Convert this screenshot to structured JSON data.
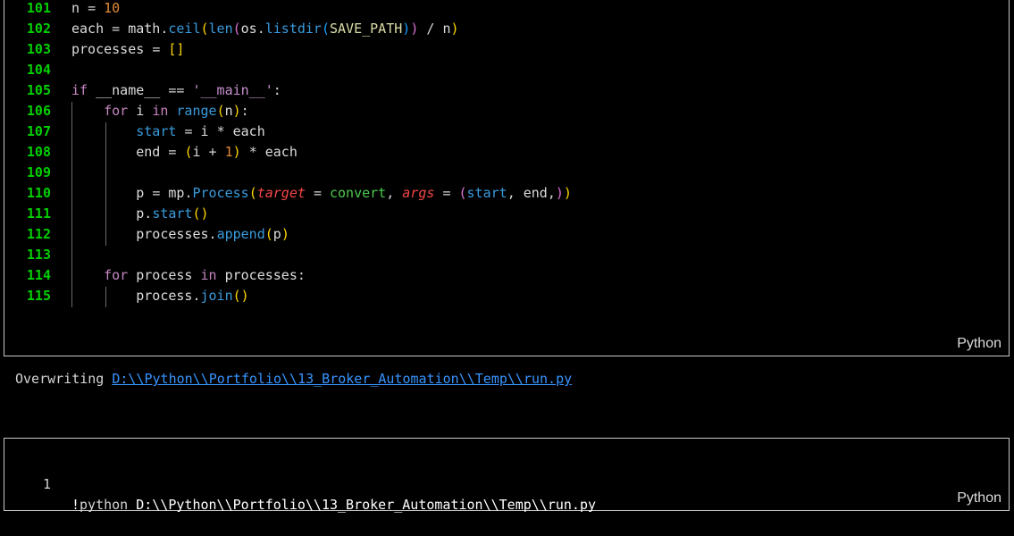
{
  "cell1": {
    "language": "Python",
    "line_numbers": [
      "101",
      "102",
      "103",
      "104",
      "105",
      "106",
      "107",
      "108",
      "109",
      "110",
      "111",
      "112",
      "113",
      "114",
      "115"
    ],
    "lines": [
      "n = 10",
      "each = math.ceil(len(os.listdir(SAVE_PATH)) / n)",
      "processes = []",
      "",
      "if __name__ == '__main__':",
      "    for i in range(n):",
      "        start = i * each",
      "        end = (i + 1) * each",
      "",
      "        p = mp.Process(target = convert, args = (start, end,))",
      "        p.start()",
      "        processes.append(p)",
      "",
      "    for process in processes:",
      "        process.join()"
    ]
  },
  "output": {
    "prefix": "Overwriting ",
    "link": "D:\\\\Python\\\\Portfolio\\\\13_Broker_Automation\\\\Temp\\\\run.py"
  },
  "cell2": {
    "language": "Python",
    "line_number": "1",
    "line": "!python D:\\\\Python\\\\Portfolio\\\\13_Broker_Automation\\\\Temp\\\\run.py"
  }
}
